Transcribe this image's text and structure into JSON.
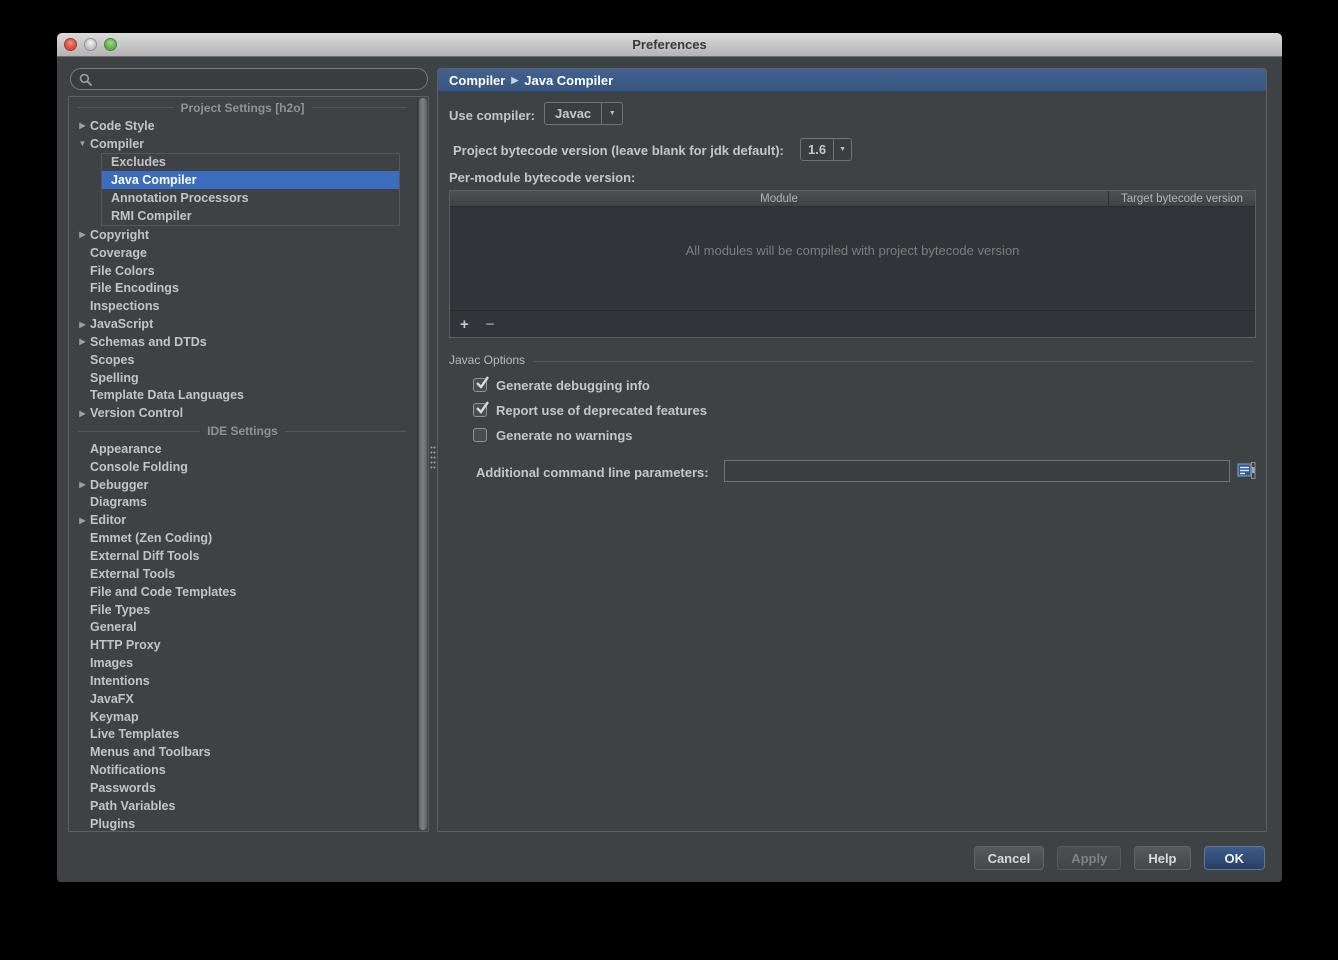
{
  "window": {
    "title": "Preferences"
  },
  "colors": {
    "selection": "#3a6dbd",
    "header_bar": "#3d5a86",
    "ok_button": "#36507c"
  },
  "sidebar": {
    "search_value": "",
    "sections": [
      {
        "label": "Project Settings [h2o]",
        "items": [
          {
            "label": "Code Style",
            "arrow": "collapsed"
          },
          {
            "label": "Compiler",
            "arrow": "expanded",
            "children": [
              {
                "label": "Excludes"
              },
              {
                "label": "Java Compiler",
                "selected": true
              },
              {
                "label": "Annotation Processors"
              },
              {
                "label": "RMI Compiler"
              }
            ]
          },
          {
            "label": "Copyright",
            "arrow": "collapsed"
          },
          {
            "label": "Coverage"
          },
          {
            "label": "File Colors"
          },
          {
            "label": "File Encodings"
          },
          {
            "label": "Inspections"
          },
          {
            "label": "JavaScript",
            "arrow": "collapsed"
          },
          {
            "label": "Schemas and DTDs",
            "arrow": "collapsed"
          },
          {
            "label": "Scopes"
          },
          {
            "label": "Spelling"
          },
          {
            "label": "Template Data Languages"
          },
          {
            "label": "Version Control",
            "arrow": "collapsed"
          }
        ]
      },
      {
        "label": "IDE Settings",
        "items": [
          {
            "label": "Appearance"
          },
          {
            "label": "Console Folding"
          },
          {
            "label": "Debugger",
            "arrow": "collapsed"
          },
          {
            "label": "Diagrams"
          },
          {
            "label": "Editor",
            "arrow": "collapsed"
          },
          {
            "label": "Emmet (Zen Coding)"
          },
          {
            "label": "External Diff Tools"
          },
          {
            "label": "External Tools"
          },
          {
            "label": "File and Code Templates"
          },
          {
            "label": "File Types"
          },
          {
            "label": "General"
          },
          {
            "label": "HTTP Proxy"
          },
          {
            "label": "Images"
          },
          {
            "label": "Intentions"
          },
          {
            "label": "JavaFX"
          },
          {
            "label": "Keymap"
          },
          {
            "label": "Live Templates"
          },
          {
            "label": "Menus and Toolbars"
          },
          {
            "label": "Notifications"
          },
          {
            "label": "Passwords"
          },
          {
            "label": "Path Variables"
          },
          {
            "label": "Plugins"
          }
        ]
      }
    ]
  },
  "main": {
    "breadcrumb": {
      "parent": "Compiler",
      "current": "Java Compiler"
    },
    "use_compiler": {
      "label": "Use compiler:",
      "value": "Javac"
    },
    "bytecode_version": {
      "label": "Project bytecode version (leave blank for jdk default):",
      "value": "1.6"
    },
    "per_module": {
      "label": "Per-module bytecode version:",
      "columns": [
        "Module",
        "Target bytecode version"
      ],
      "empty_text": "All modules will be compiled with project bytecode version",
      "toolbar": {
        "add": "+",
        "remove": "−"
      }
    },
    "javac_options": {
      "label": "Javac Options",
      "checkboxes": [
        {
          "label": "Generate debugging info",
          "checked": true
        },
        {
          "label": "Report use of deprecated features",
          "checked": true
        },
        {
          "label": "Generate no warnings",
          "checked": false
        }
      ],
      "additional_params": {
        "label": "Additional command line parameters:",
        "value": ""
      }
    }
  },
  "footer": {
    "buttons": [
      {
        "label": "Cancel",
        "style": "normal"
      },
      {
        "label": "Apply",
        "style": "disabled"
      },
      {
        "label": "Help",
        "style": "normal"
      },
      {
        "label": "OK",
        "style": "primary"
      }
    ]
  }
}
